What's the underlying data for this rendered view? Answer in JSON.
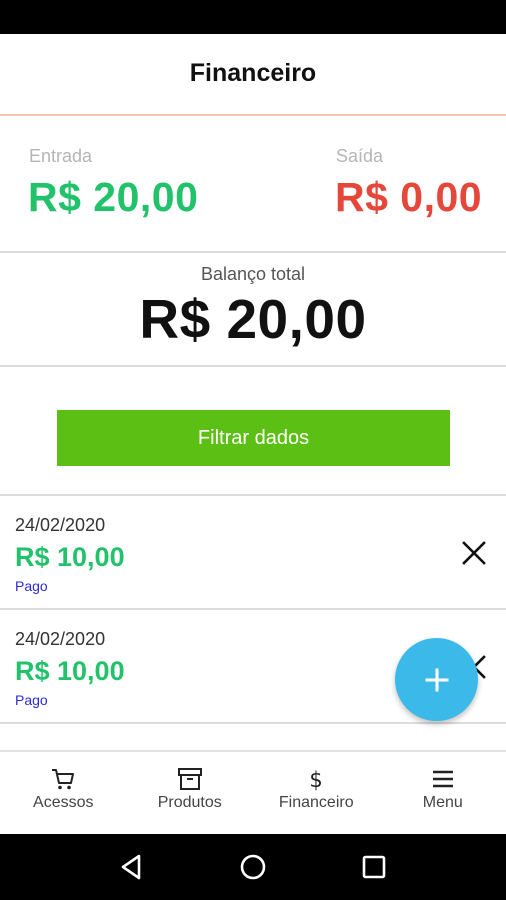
{
  "header": {
    "title": "Financeiro"
  },
  "summary": {
    "income_label": "Entrada",
    "income_value": "R$ 20,00",
    "expense_label": "Saída",
    "expense_value": "R$ 0,00"
  },
  "balance": {
    "label": "Balanço total",
    "value": "R$ 20,00"
  },
  "filter": {
    "label": "Filtrar dados"
  },
  "transactions": [
    {
      "date": "24/02/2020",
      "amount": "R$ 10,00",
      "status": "Pago"
    },
    {
      "date": "24/02/2020",
      "amount": "R$ 10,00",
      "status": "Pago"
    }
  ],
  "fab": {
    "icon": "plus-icon"
  },
  "bottom_nav": [
    {
      "label": "Acessos",
      "icon": "cart-icon"
    },
    {
      "label": "Produtos",
      "icon": "archive-box-icon"
    },
    {
      "label": "Financeiro",
      "icon": "dollar-icon"
    },
    {
      "label": "Menu",
      "icon": "hamburger-menu-icon"
    }
  ],
  "system_nav": [
    "back-icon",
    "home-icon",
    "recents-icon"
  ],
  "colors": {
    "income": "#22c26b",
    "expense": "#e5483a",
    "filter_button": "#5cbf14",
    "fab": "#3bb9e8",
    "status_link": "#2b2bd9",
    "header_divider": "#f4c3b4"
  }
}
